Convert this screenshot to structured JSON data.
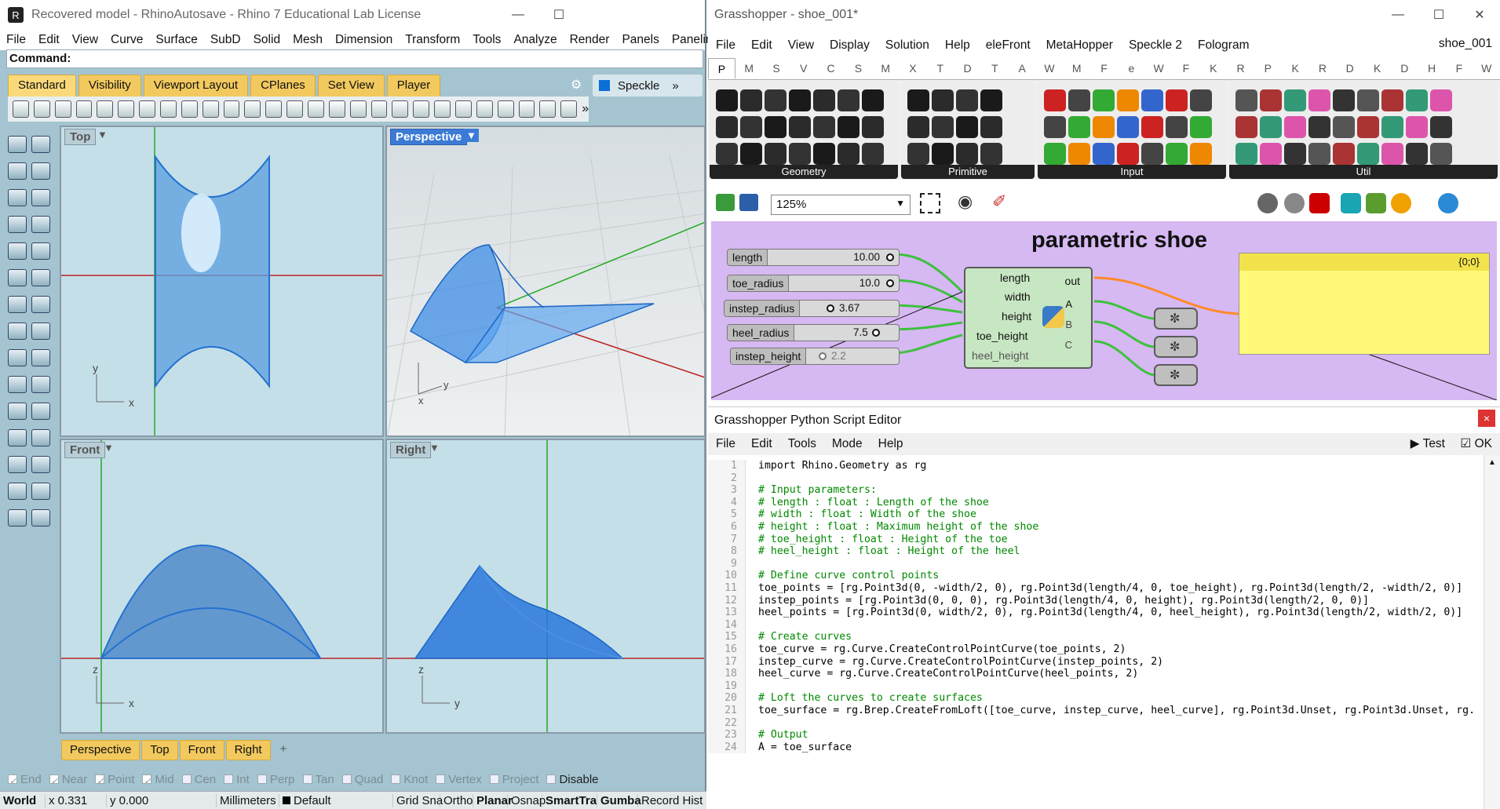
{
  "rhino": {
    "title": "Recovered model - RhinoAutosave - Rhino 7 Educational Lab License",
    "menu": [
      "File",
      "Edit",
      "View",
      "Curve",
      "Surface",
      "SubD",
      "Solid",
      "Mesh",
      "Dimension",
      "Transform",
      "Tools",
      "Analyze",
      "Render",
      "Panels",
      "Paneling Tools"
    ],
    "command_label": "Command:",
    "toolbar_tabs": [
      "Standard",
      "Visibility",
      "Viewport Layout",
      "CPlanes",
      "Set View",
      "Player"
    ],
    "speckle_tab": "Speckle",
    "viewports": {
      "top": "Top",
      "perspective": "Perspective",
      "front": "Front",
      "right": "Right"
    },
    "viewport_tabs": [
      "Perspective",
      "Top",
      "Front",
      "Right"
    ],
    "add_tab": "+",
    "snaps": [
      {
        "label": "End",
        "checked": true
      },
      {
        "label": "Near",
        "checked": true
      },
      {
        "label": "Point",
        "checked": true
      },
      {
        "label": "Mid",
        "checked": true
      },
      {
        "label": "Cen",
        "checked": false
      },
      {
        "label": "Int",
        "checked": false
      },
      {
        "label": "Perp",
        "checked": false
      },
      {
        "label": "Tan",
        "checked": false
      },
      {
        "label": "Quad",
        "checked": false
      },
      {
        "label": "Knot",
        "checked": false
      },
      {
        "label": "Vertex",
        "checked": false
      },
      {
        "label": "Project",
        "checked": false
      }
    ],
    "disable_label": "Disable",
    "status": {
      "cplane": "World",
      "x": "x 0.331",
      "y": "y 0.000",
      "units": "Millimeters",
      "layer": "Default",
      "grid_snap": "Grid Sna",
      "ortho": "Ortho",
      "planar": "Planar",
      "osnap": "Osnap",
      "smarttrack": "SmartTra",
      "gumball": "Gumba",
      "record_history": "Record Hist"
    },
    "axis": {
      "x": "x",
      "y": "y",
      "z": "z"
    }
  },
  "gh": {
    "title": "Grasshopper - shoe_001*",
    "menu": [
      "File",
      "Edit",
      "View",
      "Display",
      "Solution",
      "Help",
      "eleFront",
      "MetaHopper",
      "Speckle 2",
      "Fologram"
    ],
    "doc_name": "shoe_001",
    "category_tabs": [
      "P",
      "M",
      "S",
      "V",
      "C",
      "S",
      "M",
      "X",
      "T",
      "D",
      "T",
      "A",
      "W",
      "M",
      "F",
      "e",
      "W",
      "F",
      "K",
      "R",
      "P",
      "K",
      "R",
      "D",
      "K",
      "D",
      "H",
      "F",
      "W"
    ],
    "panels": [
      "Geometry",
      "Primitive",
      "Input",
      "Util"
    ],
    "zoom": "125%",
    "canvas_title": "parametric shoe",
    "sliders": [
      {
        "name": "length",
        "value": "10.00"
      },
      {
        "name": "toe_radius",
        "value": "10.0"
      },
      {
        "name": "instep_radius",
        "value": "3.67"
      },
      {
        "name": "heel_radius",
        "value": "7.5"
      },
      {
        "name": "instep_height",
        "value": "2.2"
      }
    ],
    "python_inputs": [
      "length",
      "width",
      "height",
      "toe_height",
      "heel_height"
    ],
    "python_outputs": [
      "out",
      "A",
      "B",
      "C"
    ],
    "panel_header": "{0;0}"
  },
  "editor": {
    "title": "Grasshopper Python Script Editor",
    "close": "×",
    "menu": [
      "File",
      "Edit",
      "Tools",
      "Mode",
      "Help"
    ],
    "test": "Test",
    "ok": "OK",
    "line_numbers": [
      "1",
      "2",
      "3",
      "4",
      "5",
      "6",
      "7",
      "8",
      "9",
      "10",
      "11",
      "12",
      "13",
      "14",
      "15",
      "16",
      "17",
      "18",
      "19",
      "20",
      "21",
      "22",
      "23",
      "24"
    ],
    "lines": [
      "import Rhino.Geometry as rg",
      "",
      "# Input parameters:",
      "# length : float : Length of the shoe",
      "# width : float : Width of the shoe",
      "# height : float : Maximum height of the shoe",
      "# toe_height : float : Height of the toe",
      "# heel_height : float : Height of the heel",
      "",
      "# Define curve control points",
      "toe_points = [rg.Point3d(0, -width/2, 0), rg.Point3d(length/4, 0, toe_height), rg.Point3d(length/2, -width/2, 0)]",
      "instep_points = [rg.Point3d(0, 0, 0), rg.Point3d(length/4, 0, height), rg.Point3d(length/2, 0, 0)]",
      "heel_points = [rg.Point3d(0, width/2, 0), rg.Point3d(length/4, 0, heel_height), rg.Point3d(length/2, width/2, 0)]",
      "",
      "# Create curves",
      "toe_curve = rg.Curve.CreateControlPointCurve(toe_points, 2)",
      "instep_curve = rg.Curve.CreateControlPointCurve(instep_points, 2)",
      "heel_curve = rg.Curve.CreateControlPointCurve(heel_points, 2)",
      "",
      "# Loft the curves to create surfaces",
      "toe_surface = rg.Brep.CreateFromLoft([toe_curve, instep_curve, heel_curve], rg.Point3d.Unset, rg.Point3d.Unset, rg.",
      "",
      "# Output",
      "A = toe_surface"
    ]
  }
}
